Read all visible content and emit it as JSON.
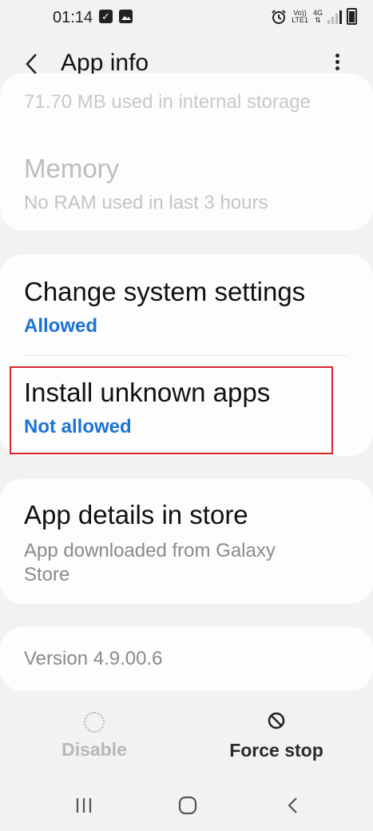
{
  "status_bar": {
    "time": "01:14",
    "left_icons": [
      "check-icon",
      "image-icon"
    ],
    "right_icons": [
      "alarm-icon",
      "volte-icon",
      "lte-4g-icon",
      "signal-icon",
      "battery-icon"
    ],
    "volte_top": "Vo))",
    "volte_bottom": "LTE1",
    "net": "4G"
  },
  "app_bar": {
    "title": "App info",
    "back_icon": "back-arrow-icon",
    "more_icon": "more-vertical-icon"
  },
  "storage_card": {
    "clipped_text": "71.70 MB used in internal storage",
    "memory_title": "Memory",
    "memory_subtitle": "No RAM used in last 3 hours"
  },
  "permissions_card": {
    "change_settings_title": "Change system settings",
    "change_settings_value": "Allowed",
    "install_unknown_title": "Install unknown apps",
    "install_unknown_value": "Not allowed"
  },
  "store_card": {
    "title": "App details in store",
    "subtitle_line1": "App downloaded from Galaxy",
    "subtitle_line2": "Store"
  },
  "version_card": {
    "text": "Version 4.9.00.6"
  },
  "actions": {
    "disable_label": "Disable",
    "force_stop_label": "Force stop"
  },
  "nav_bar": {
    "icons": [
      "recent-apps-icon",
      "home-icon",
      "back-icon"
    ]
  },
  "colors": {
    "accent_blue": "#1a72d6",
    "highlight_red": "#d8262c",
    "background": "#f2f2f2",
    "card": "#fdfdfd"
  }
}
